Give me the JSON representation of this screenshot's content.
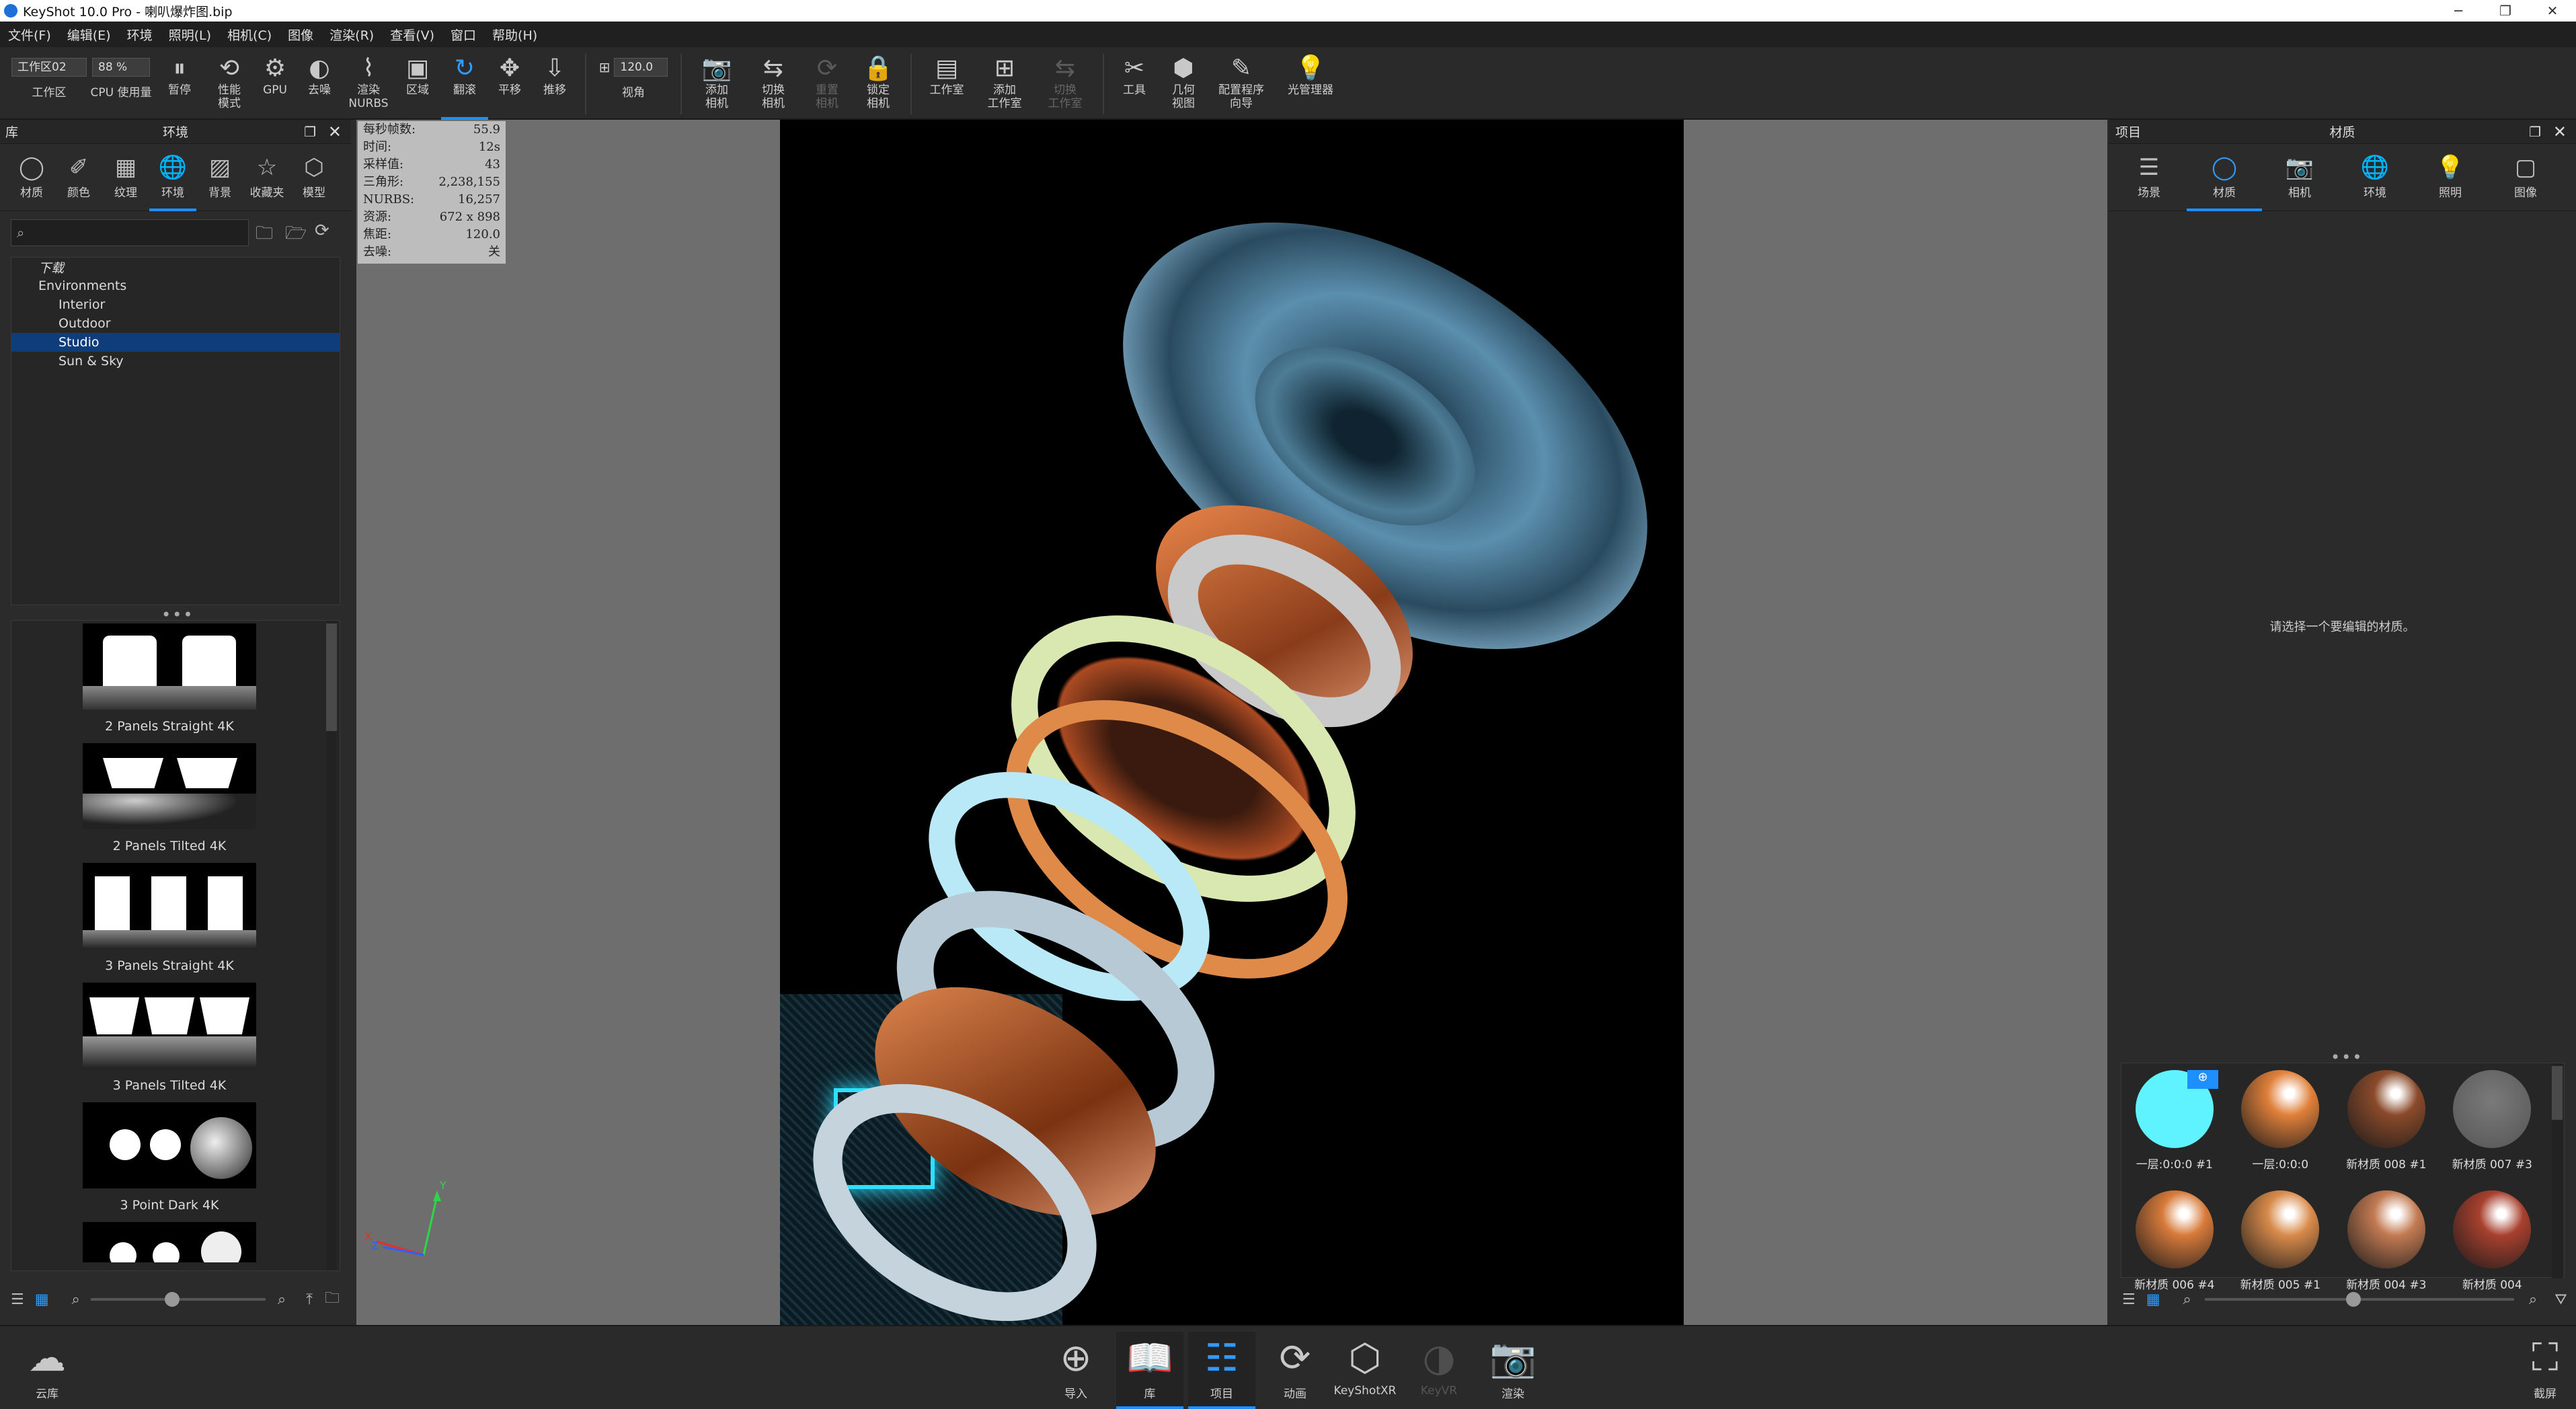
{
  "window": {
    "title": "KeyShot 10.0 Pro - 喇叭爆炸图.bip",
    "minimize": "─",
    "restore": "❐",
    "close": "✕"
  },
  "menu": [
    "文件(F)",
    "编辑(E)",
    "环境",
    "照明(L)",
    "相机(C)",
    "图像",
    "渲染(R)",
    "查看(V)",
    "窗口",
    "帮助(H)"
  ],
  "toolbar": {
    "workspace_value": "工作区02",
    "workspace_label": "工作区",
    "cpu_value": "88 %",
    "cpu_label": "CPU 使用量",
    "fov_value": "120.0",
    "fov_label": "视角",
    "buttons": [
      {
        "id": "pause",
        "icon": "pause-icon",
        "label": "暂停",
        "state": "normal"
      },
      {
        "id": "perf",
        "icon": "performance-mode-icon",
        "label": "性能\n模式",
        "state": "normal"
      },
      {
        "id": "gpu",
        "icon": "gpu-icon",
        "label": "GPU",
        "state": "normal"
      },
      {
        "id": "denoise",
        "icon": "denoise-icon",
        "label": "去噪",
        "state": "normal"
      },
      {
        "id": "nurbs",
        "icon": "nurbs-icon",
        "label": "渲染\nNURBS",
        "state": "normal"
      },
      {
        "id": "region",
        "icon": "region-icon",
        "label": "区域",
        "state": "normal"
      },
      {
        "id": "tumble",
        "icon": "tumble-icon",
        "label": "翻滚",
        "state": "active"
      },
      {
        "id": "pan",
        "icon": "pan-icon",
        "label": "平移",
        "state": "normal"
      },
      {
        "id": "dolly",
        "icon": "dolly-icon",
        "label": "推移",
        "state": "normal"
      },
      {
        "id": "addcam",
        "icon": "add-camera-icon",
        "label": "添加\n相机",
        "state": "normal"
      },
      {
        "id": "switchcam",
        "icon": "switch-camera-icon",
        "label": "切换\n相机",
        "state": "normal"
      },
      {
        "id": "resetcam",
        "icon": "reset-camera-icon",
        "label": "重置\n相机",
        "state": "disabled"
      },
      {
        "id": "lockcam",
        "icon": "lock-camera-icon",
        "label": "锁定\n相机",
        "state": "normal"
      },
      {
        "id": "studio",
        "icon": "studio-icon",
        "label": "工作室",
        "state": "normal"
      },
      {
        "id": "addstudio",
        "icon": "add-studio-icon",
        "label": "添加\n工作室",
        "state": "normal"
      },
      {
        "id": "switchstudio",
        "icon": "switch-studio-icon",
        "label": "切换\n工作室",
        "state": "disabled"
      },
      {
        "id": "tools",
        "icon": "tools-icon",
        "label": "工具",
        "state": "normal"
      },
      {
        "id": "geoview",
        "icon": "geometry-view-icon",
        "label": "几何\n视图",
        "state": "normal"
      },
      {
        "id": "wizard",
        "icon": "configurator-wizard-icon",
        "label": "配置程序\n向导",
        "state": "normal"
      },
      {
        "id": "lightmgr",
        "icon": "light-manager-icon",
        "label": "光管理器",
        "state": "normal"
      }
    ]
  },
  "library": {
    "header_left": "库",
    "header_title": "环境",
    "tabs": [
      {
        "icon": "material-icon",
        "label": "材质"
      },
      {
        "icon": "color-icon",
        "label": "颜色"
      },
      {
        "icon": "texture-icon",
        "label": "纹理"
      },
      {
        "icon": "environment-icon",
        "label": "环境",
        "active": true
      },
      {
        "icon": "background-icon",
        "label": "背景"
      },
      {
        "icon": "favorites-icon",
        "label": "收藏夹"
      },
      {
        "icon": "model-icon",
        "label": "模型"
      }
    ],
    "search_placeholder": "",
    "tree": [
      {
        "label": "下载",
        "level": 0,
        "italic": true
      },
      {
        "label": "Environments",
        "level": 0,
        "expanded": true
      },
      {
        "label": "Interior",
        "level": 1
      },
      {
        "label": "Outdoor",
        "level": 1
      },
      {
        "label": "Studio",
        "level": 1,
        "selected": true
      },
      {
        "label": "Sun & Sky",
        "level": 1
      }
    ],
    "thumbnails": [
      "2 Panels Straight 4K",
      "2 Panels Tilted 4K",
      "3 Panels Straight 4K",
      "3 Panels Tilted 4K",
      "3 Point Dark 4K"
    ]
  },
  "stats": [
    {
      "k": "每秒帧数:",
      "v": "55.9"
    },
    {
      "k": "时间:",
      "v": "12s"
    },
    {
      "k": "采样值:",
      "v": "43"
    },
    {
      "k": "三角形:",
      "v": "2,238,155"
    },
    {
      "k": "NURBS:",
      "v": "16,257"
    },
    {
      "k": "资源:",
      "v": "672 x 898"
    },
    {
      "k": "焦距:",
      "v": "120.0"
    },
    {
      "k": "去噪:",
      "v": "关"
    }
  ],
  "axes": {
    "x": "X",
    "y": "Y",
    "z": "Z"
  },
  "project": {
    "header_left": "项目",
    "header_title": "材质",
    "tabs": [
      {
        "icon": "scene-icon",
        "label": "场景"
      },
      {
        "icon": "material-icon",
        "label": "材质",
        "active": true
      },
      {
        "icon": "camera-icon",
        "label": "相机"
      },
      {
        "icon": "environment-icon",
        "label": "环境"
      },
      {
        "icon": "lighting-icon",
        "label": "照明"
      },
      {
        "icon": "image-icon",
        "label": "图像"
      }
    ],
    "hint": "请选择一个要编辑的材质。",
    "materials": [
      {
        "name": "一层:0:0:0 #1",
        "color": "#5ef3ff"
      },
      {
        "name": "一层:0:0:0",
        "color": "#e0803a"
      },
      {
        "name": "新材质 008 #1",
        "color": "#8a4a2a"
      },
      {
        "name": "新材质 007 #3",
        "color": "#6e6e6e"
      },
      {
        "name": "新材质 006 #4",
        "color": "#d77a3a"
      },
      {
        "name": "新材质 005 #1",
        "color": "#d88a4a"
      },
      {
        "name": "新材质 004 #3",
        "color": "#c27a52"
      },
      {
        "name": "新材质 004",
        "color": "#a8402e"
      }
    ]
  },
  "bottom": [
    {
      "icon": "cloud-library-icon",
      "label": "云库",
      "state": "normal"
    },
    {
      "icon": "import-icon",
      "label": "导入",
      "state": "normal"
    },
    {
      "icon": "library-icon",
      "label": "库",
      "state": "active"
    },
    {
      "icon": "project-icon",
      "label": "项目",
      "state": "active"
    },
    {
      "icon": "animation-icon",
      "label": "动画",
      "state": "normal"
    },
    {
      "icon": "keyshotxr-icon",
      "label": "KeyShotXR",
      "state": "normal"
    },
    {
      "icon": "keyvr-icon",
      "label": "KeyVR",
      "state": "disabled"
    },
    {
      "icon": "render-icon",
      "label": "渲染",
      "state": "normal"
    },
    {
      "icon": "screenshot-icon",
      "label": "截屏",
      "state": "normal"
    }
  ]
}
